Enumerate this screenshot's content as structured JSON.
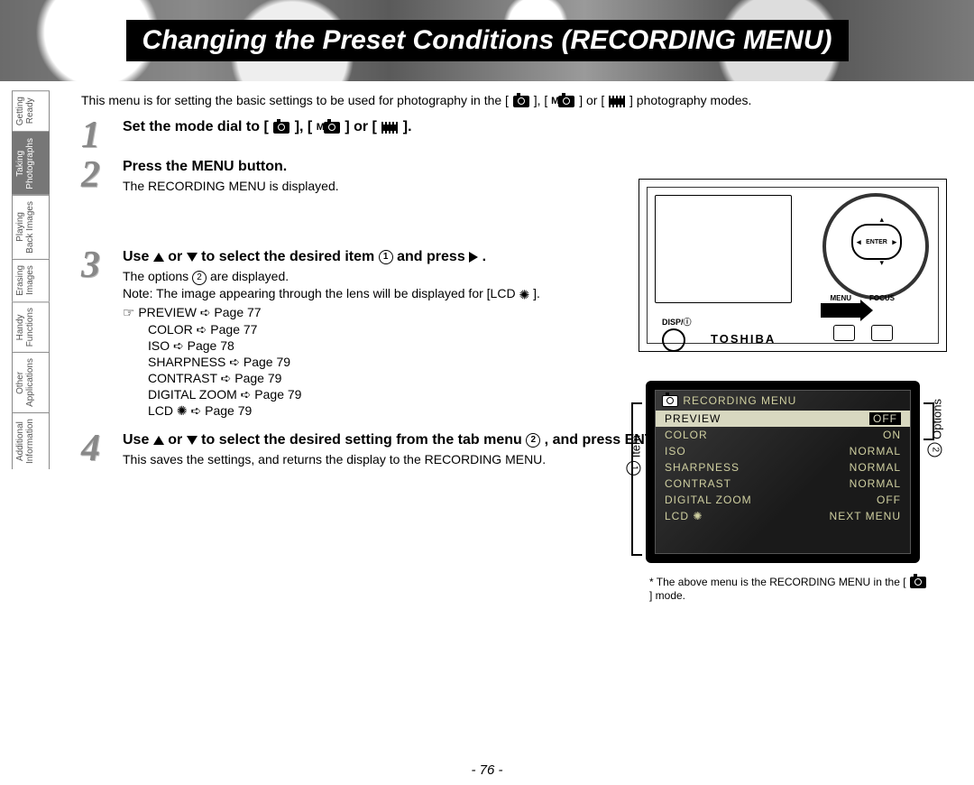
{
  "banner_title": "Changing the Preset Conditions (RECORDING MENU)",
  "tabs": [
    {
      "l1": "Getting",
      "l2": "Ready"
    },
    {
      "l1": "Taking",
      "l2": "Photographs"
    },
    {
      "l1": "Playing",
      "l2": "Back Images"
    },
    {
      "l1": "Erasing",
      "l2": "Images"
    },
    {
      "l1": "Handy",
      "l2": "Functions"
    },
    {
      "l1": "Other",
      "l2": "Applications"
    },
    {
      "l1": "Additional",
      "l2": "Information"
    }
  ],
  "active_tab_index": 1,
  "intro_a": "This menu is for setting the basic settings to be used for photography in the [ ",
  "intro_b": " ], [ ",
  "intro_c": " ] or [ ",
  "intro_d": " ] photography modes.",
  "step1": {
    "title_a": "Set the mode dial to [ ",
    "title_b": " ], [ ",
    "title_c": " ] or [ ",
    "title_d": " ]."
  },
  "step2": {
    "title": "Press the MENU button.",
    "text": "The RECORDING MENU is displayed."
  },
  "step3": {
    "title_a": "Use ",
    "title_b": " or ",
    "title_c": " to select the desired item ",
    "title_d": " and press ",
    "title_e": ".",
    "opt_a": "The options ",
    "opt_b": " are displayed.",
    "note": "Note: The image appearing through the lens will be displayed for [LCD ",
    "note_end": " ].",
    "refs": [
      "PREVIEW ➪ Page 77",
      "COLOR ➪ Page 77",
      "ISO ➪ Page 78",
      "SHARPNESS ➪ Page 79",
      "CONTRAST ➪ Page 79",
      "DIGITAL ZOOM ➪ Page 79",
      "LCD ✺ ➪ Page 79"
    ]
  },
  "step4": {
    "title_a": "Use ",
    "title_b": " or ",
    "title_c": " to select the desired setting from the tab menu ",
    "title_d": ", and press ENTER.",
    "text": "This saves the settings, and returns the display to the RECORDING MENU."
  },
  "camera": {
    "enter": "ENTER",
    "menu": "MENU",
    "focus": "FOCUS",
    "disp": "DISP/ⓘ",
    "brand": "TOSHIBA"
  },
  "lcd": {
    "title": "RECORDING MENU",
    "rows": [
      {
        "k": "PREVIEW",
        "v": "OFF",
        "sel": true
      },
      {
        "k": "COLOR",
        "v": "ON"
      },
      {
        "k": "ISO",
        "v": "NORMAL"
      },
      {
        "k": "SHARPNESS",
        "v": "NORMAL"
      },
      {
        "k": "CONTRAST",
        "v": "NORMAL"
      },
      {
        "k": "DIGITAL ZOOM",
        "v": "OFF"
      },
      {
        "k": "LCD ✺",
        "v": "NEXT MENU"
      }
    ],
    "item_label_a": " Item",
    "opt_label_a": " Options",
    "note_a": "* The above menu is the RECORDING MENU in the [ ",
    "note_b": " ] mode."
  },
  "circ1": "1",
  "circ2": "2",
  "m_letter": "M",
  "page_number": "- 76 -"
}
